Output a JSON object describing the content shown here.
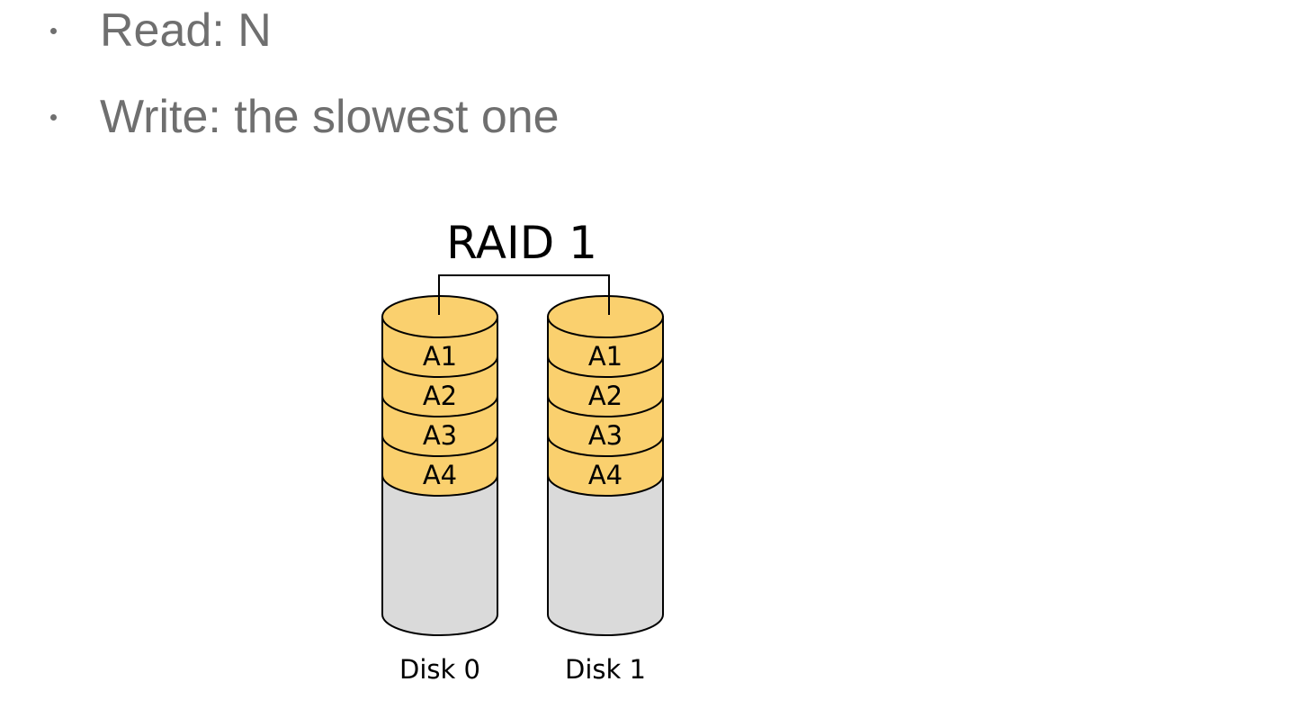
{
  "bullets": [
    {
      "text": "Read: N"
    },
    {
      "text": "Write: the slowest one"
    }
  ],
  "diagram": {
    "title": "RAID 1",
    "disks": [
      {
        "label": "Disk 0",
        "blocks": [
          "A1",
          "A2",
          "A3",
          "A4"
        ]
      },
      {
        "label": "Disk 1",
        "blocks": [
          "A1",
          "A2",
          "A3",
          "A4"
        ]
      }
    ],
    "colors": {
      "block_fill": "#fad06e",
      "empty_fill": "#dadada",
      "stroke": "#000000",
      "bullet_text": "#6f6f6f"
    }
  }
}
